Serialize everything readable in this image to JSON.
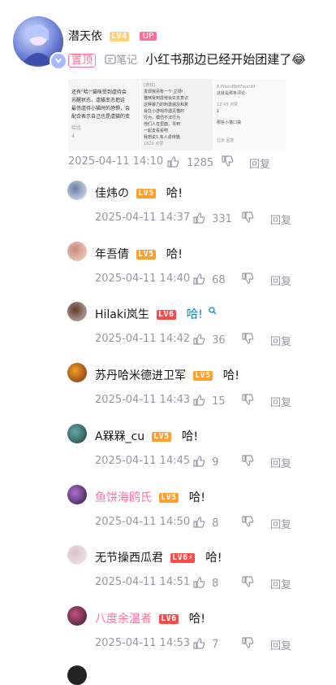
{
  "main_comment": {
    "user": "潜天依",
    "level": "LV4",
    "up_badge": "UP",
    "pinned_badge": "置顶",
    "note_tag": "笔记",
    "text": "小红书那边已经开始团建了",
    "emoji": "😂",
    "time": "2025-04-11 14:10",
    "likes": "1285",
    "reply": "回复",
    "img1": {
      "lines": [
        "还有\"哈!\"猫咪受到虐待会",
        "苏醒状态，虐猫变态把这",
        "最伤虐待小猫时的恐惧，会",
        "配合表示自己也是虐猫的变"
      ],
      "foot": [
        "哈比",
        "4"
      ]
    },
    "img2": {
      "title": "[游戏]",
      "lines": [
        "发现我另有一个:立场!",
        "猫咪受到虐待会失去意识",
        "这种暴力的刺激遍及和复",
        "会在小游戏中遇见猫的",
        "行为，模仿不法行为",
        "他们人在里面，寻到",
        "一起去看看吧",
        "我想说1.有人虐待猫"
      ],
      "foot": "1820 点赞"
    },
    "img3": {
      "header": [
        "A FriendNotFound4",
        "这就是那条评论"
      ],
      "lines": [
        "12:43 点赞",
        "1",
        "那些小猫口袋"
      ],
      "foot": "北京 回复"
    }
  },
  "replies": [
    {
      "user": "佳炜の",
      "level": "LV5",
      "text": "哈!",
      "time": "2025-04-11 14:37",
      "likes": "331",
      "reply": "回复",
      "name_color": "#18191c"
    },
    {
      "user": "年吾倩",
      "level": "LV5",
      "text": "哈!",
      "time": "2025-04-11 14:40",
      "likes": "68",
      "reply": "回复",
      "name_color": "#18191c"
    },
    {
      "user": "Hilaki岚生",
      "level": "LV6",
      "text": "哈!",
      "time": "2025-04-11 14:42",
      "likes": "36",
      "reply": "回复",
      "name_color": "#18191c",
      "text_color": "#008ac5"
    },
    {
      "user": "苏丹哈米德进卫军",
      "level": "LV5",
      "text": "哈!",
      "time": "2025-04-11 14:43",
      "likes": "15",
      "reply": "回复",
      "name_color": "#18191c"
    },
    {
      "user": "A槑槑_cu",
      "level": "LV5",
      "text": "哈!",
      "time": "2025-04-11 14:45",
      "likes": "9",
      "reply": "回复",
      "name_color": "#18191c"
    },
    {
      "user": "鱼饼海鸥氏",
      "level": "LV5",
      "text": "哈!",
      "time": "2025-04-11 14:50",
      "likes": "8",
      "reply": "回复",
      "name_color": "#fb7299"
    },
    {
      "user": "无节操西瓜君",
      "level": "LV6⚡",
      "text": "哈!",
      "time": "2025-04-11 14:51",
      "likes": "8",
      "reply": "回复",
      "name_color": "#18191c"
    },
    {
      "user": "八度余温者",
      "level": "LV6",
      "text": "哈!",
      "time": "2025-04-11 14:53",
      "likes": "7",
      "reply": "回复",
      "name_color": "#fb7299"
    }
  ],
  "colors": {
    "pink": "#fb7299",
    "blue": "#008ac5",
    "gray": "#9499a0"
  }
}
